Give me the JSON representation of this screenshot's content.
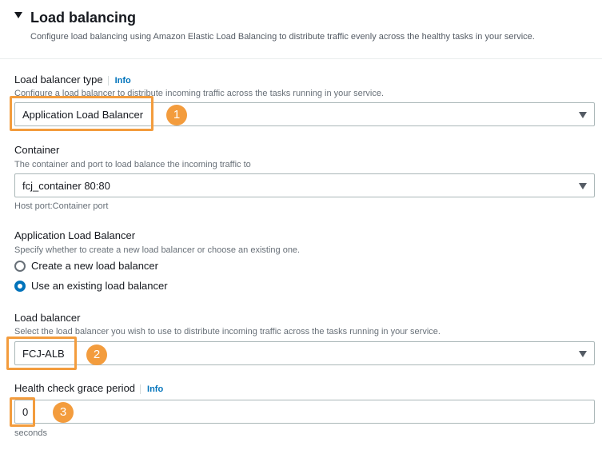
{
  "section": {
    "title": "Load balancing",
    "description": "Configure load balancing using Amazon Elastic Load Balancing to distribute traffic evenly across the healthy tasks in your service."
  },
  "lb_type": {
    "label": "Load balancer type",
    "info": "Info",
    "description": "Configure a load balancer to distribute incoming traffic across the tasks running in your service.",
    "value": "Application Load Balancer"
  },
  "container": {
    "label": "Container",
    "description": "The container and port to load balance the incoming traffic to",
    "value": "fcj_container 80:80",
    "hint": "Host port:Container port"
  },
  "alb": {
    "label": "Application Load Balancer",
    "description": "Specify whether to create a new load balancer or choose an existing one.",
    "options": [
      "Create a new load balancer",
      "Use an existing load balancer"
    ],
    "selected_index": 1
  },
  "load_balancer": {
    "label": "Load balancer",
    "description": "Select the load balancer you wish to use to distribute incoming traffic across the tasks running in your service.",
    "value": "FCJ-ALB"
  },
  "grace": {
    "label": "Health check grace period",
    "info": "Info",
    "value": "0",
    "unit": "seconds"
  },
  "annotations": [
    "1",
    "2",
    "3"
  ],
  "colors": {
    "accent": "#0073bb",
    "highlight": "#f39c3d"
  }
}
